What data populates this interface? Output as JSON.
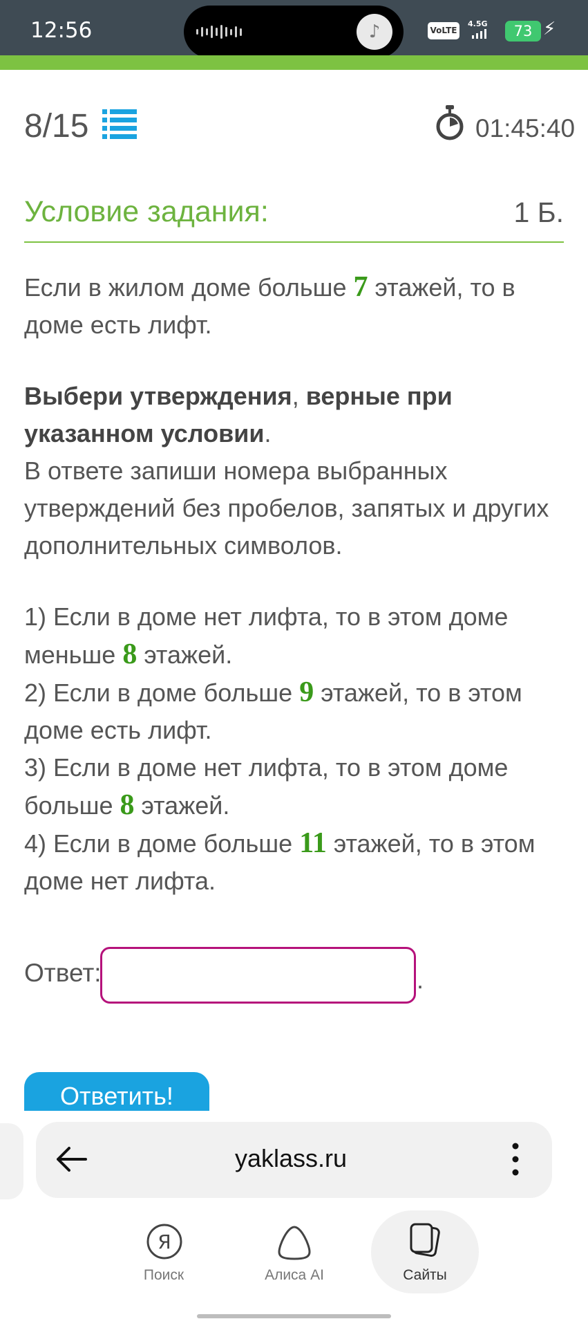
{
  "status_bar": {
    "time": "12:56",
    "volte": "VoLTE",
    "network": "4.5G",
    "battery": "73"
  },
  "task": {
    "counter": "8/15",
    "timer": "01:45:40",
    "condition_title": "Условие задания:",
    "points": "1 Б."
  },
  "problem": {
    "intro_part1": "Если в жилом доме больше ",
    "intro_num": "7",
    "intro_part2": " этажей, то в доме есть лифт.",
    "instruction_bold1": "Выбери утверждения",
    "instruction_comma": ", ",
    "instruction_bold2": "верные при указанном условии",
    "instruction_dot": ".",
    "instruction_rest": "В ответе запиши номера выбранных утверждений без пробелов, запятых и других дополнительных символов.",
    "statements": [
      {
        "before": "1) Если в доме нет лифта, то в этом доме меньше ",
        "num": "8",
        "after": " этажей."
      },
      {
        "before": "2) Если в доме больше ",
        "num": "9",
        "after": " этажей, то в этом доме есть лифт."
      },
      {
        "before": "3) Если в доме нет лифта, то в этом доме больше ",
        "num": "8",
        "after": " этажей."
      },
      {
        "before": "4) Если в доме больше ",
        "num": "11",
        "after": " этажей, то в этом доме нет лифта."
      }
    ]
  },
  "answer": {
    "label": "Ответ:",
    "value": "",
    "dot": "."
  },
  "submit_label": "Ответить!",
  "browser": {
    "url": "yaklass.ru",
    "tabs": [
      {
        "label": "Поиск",
        "icon": "yandex-search-icon"
      },
      {
        "label": "Алиса AI",
        "icon": "alice-icon"
      },
      {
        "label": "Сайты",
        "icon": "sites-icon"
      }
    ]
  },
  "colors": {
    "accent_green": "#7dc242",
    "title_green": "#6db33f",
    "number_green": "#3a9a1a",
    "input_border": "#b5127b",
    "button_blue": "#1aa3e0",
    "status_bar": "#3f4b54"
  }
}
